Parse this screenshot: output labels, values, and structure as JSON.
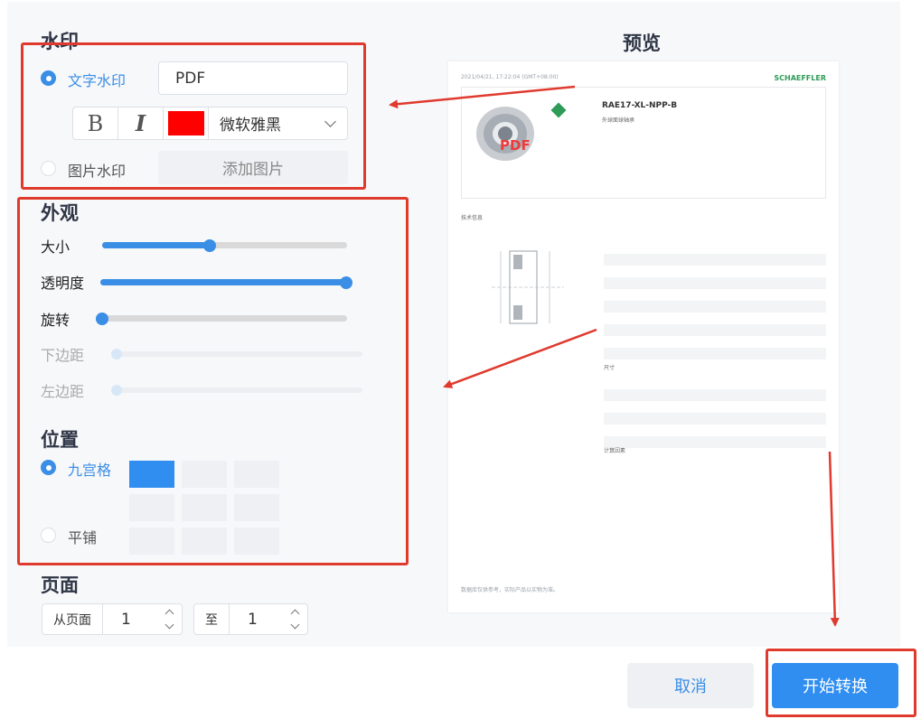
{
  "watermark": {
    "section_title": "水印",
    "text_option_label": "文字水印",
    "text_value": "PDF",
    "bold_label": "B",
    "italic_label": "I",
    "color": "#ff0000",
    "font_name": "微软雅黑",
    "image_option_label": "图片水印",
    "add_image_label": "添加图片"
  },
  "appearance": {
    "section_title": "外观",
    "size_label": "大小",
    "size_value": 0.44,
    "opacity_label": "透明度",
    "opacity_value": 1.0,
    "rotation_label": "旋转",
    "rotation_value": 0.0,
    "bottom_margin_label": "下边距",
    "bottom_margin_value": 0.0,
    "left_margin_label": "左边距",
    "left_margin_value": 0.0
  },
  "position": {
    "section_title": "位置",
    "grid_label": "九宫格",
    "tile_label": "平铺",
    "grid_selected_cell": 0
  },
  "pages": {
    "section_title": "页面",
    "from_label": "从页面",
    "from_value": "1",
    "to_label": "至",
    "to_value": "1"
  },
  "preview": {
    "title": "预览",
    "timestamp": "2021/04/21, 17:22:04 (GMT+08:00)",
    "brand": "SCHAEFFLER",
    "product": "RAE17-XL-NPP-B",
    "product_sub": "外球面球轴承",
    "watermark_text": "PDF",
    "section_tech": "技术信息",
    "section_dims": "尺寸",
    "section_calc": "计算因素",
    "footer": "数据库仅供参考，实际产品以实物为准。"
  },
  "actions": {
    "cancel_label": "取消",
    "start_label": "开始转换"
  },
  "colors": {
    "accent": "#3a8ee6",
    "primary_button": "#2f8ef0",
    "highlight_box": "#e03a2e"
  }
}
